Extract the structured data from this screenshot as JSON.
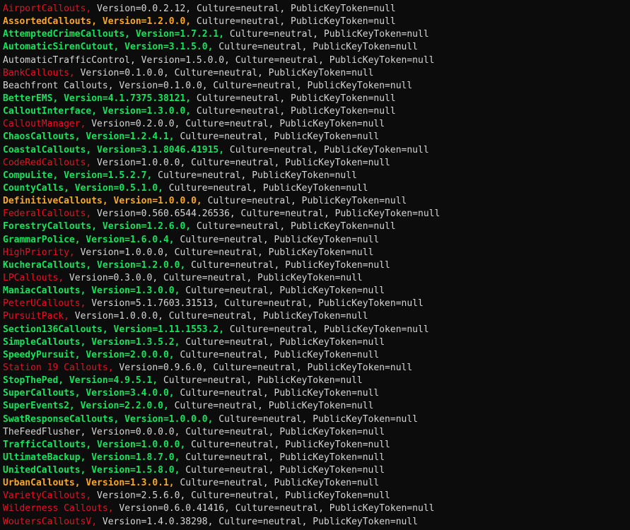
{
  "colors": {
    "background": "#0c0c0c",
    "red": "#e81123",
    "orange": "#f9a825",
    "green": "#16e35c",
    "white": "#d6d6d6",
    "partial_top_line": "#2a6fdb"
  },
  "lines": [
    {
      "name": "AirportCallouts,",
      "info": " Version=0.0.2.12, Culture=neutral, PublicKeyToken=null",
      "color": "red"
    },
    {
      "name": "AssortedCallouts, Version=1.2.0.0,",
      "info": " Culture=neutral, PublicKeyToken=null",
      "color": "orange"
    },
    {
      "name": "AttemptedCrimeCallouts, Version=1.7.2.1,",
      "info": " Culture=neutral, PublicKeyToken=null",
      "color": "green"
    },
    {
      "name": "AutomaticSirenCutout, Version=3.1.5.0,",
      "info": " Culture=neutral, PublicKeyToken=null",
      "color": "green"
    },
    {
      "name": "AutomaticTrafficControl,",
      "info": " Version=1.5.0.0, Culture=neutral, PublicKeyToken=null",
      "color": "white"
    },
    {
      "name": "BankCallouts,",
      "info": " Version=0.1.0.0, Culture=neutral, PublicKeyToken=null",
      "color": "red"
    },
    {
      "name": "Beachfront Callouts,",
      "info": " Version=0.1.0.0, Culture=neutral, PublicKeyToken=null",
      "color": "white"
    },
    {
      "name": "BetterEMS, Version=4.1.7375.38121,",
      "info": " Culture=neutral, PublicKeyToken=null",
      "color": "green"
    },
    {
      "name": "CalloutInterface, Version=1.3.0.0,",
      "info": " Culture=neutral, PublicKeyToken=null",
      "color": "green"
    },
    {
      "name": "CalloutManager,",
      "info": " Version=0.2.0.0, Culture=neutral, PublicKeyToken=null",
      "color": "red"
    },
    {
      "name": "ChaosCallouts, Version=1.2.4.1,",
      "info": " Culture=neutral, PublicKeyToken=null",
      "color": "green"
    },
    {
      "name": "CoastalCallouts, Version=3.1.8046.41915,",
      "info": " Culture=neutral, PublicKeyToken=null",
      "color": "green"
    },
    {
      "name": "CodeRedCallouts,",
      "info": " Version=1.0.0.0, Culture=neutral, PublicKeyToken=null",
      "color": "red"
    },
    {
      "name": "CompuLite, Version=1.5.2.7,",
      "info": " Culture=neutral, PublicKeyToken=null",
      "color": "green"
    },
    {
      "name": "CountyCalls, Version=0.5.1.0,",
      "info": " Culture=neutral, PublicKeyToken=null",
      "color": "green"
    },
    {
      "name": "DefinitiveCallouts, Version=1.0.0.0,",
      "info": " Culture=neutral, PublicKeyToken=null",
      "color": "orange"
    },
    {
      "name": "FederalCallouts,",
      "info": " Version=0.560.6544.26536, Culture=neutral, PublicKeyToken=null",
      "color": "red"
    },
    {
      "name": "ForestryCallouts, Version=1.2.6.0,",
      "info": " Culture=neutral, PublicKeyToken=null",
      "color": "green"
    },
    {
      "name": "GrammarPolice, Version=1.6.0.4,",
      "info": " Culture=neutral, PublicKeyToken=null",
      "color": "green"
    },
    {
      "name": "HighPriority,",
      "info": " Version=1.0.0.0, Culture=neutral, PublicKeyToken=null",
      "color": "red"
    },
    {
      "name": "KucheraCallouts, Version=1.2.0.0,",
      "info": " Culture=neutral, PublicKeyToken=null",
      "color": "green"
    },
    {
      "name": "LPCallouts,",
      "info": " Version=0.3.0.0, Culture=neutral, PublicKeyToken=null",
      "color": "red"
    },
    {
      "name": "ManiacCallouts, Version=1.3.0.0,",
      "info": " Culture=neutral, PublicKeyToken=null",
      "color": "green"
    },
    {
      "name": "PeterUCallouts,",
      "info": " Version=5.1.7603.31513, Culture=neutral, PublicKeyToken=null",
      "color": "red"
    },
    {
      "name": "PursuitPack,",
      "info": " Version=1.0.0.0, Culture=neutral, PublicKeyToken=null",
      "color": "red"
    },
    {
      "name": "Section136Callouts, Version=1.11.1553.2,",
      "info": " Culture=neutral, PublicKeyToken=null",
      "color": "green"
    },
    {
      "name": "SimpleCallouts, Version=1.3.5.2,",
      "info": " Culture=neutral, PublicKeyToken=null",
      "color": "green"
    },
    {
      "name": "SpeedyPursuit, Version=2.0.0.0,",
      "info": " Culture=neutral, PublicKeyToken=null",
      "color": "green"
    },
    {
      "name": "Station 19 Callouts,",
      "info": " Version=0.9.6.0, Culture=neutral, PublicKeyToken=null",
      "color": "red"
    },
    {
      "name": "StopThePed, Version=4.9.5.1,",
      "info": " Culture=neutral, PublicKeyToken=null",
      "color": "green"
    },
    {
      "name": "SuperCallouts, Version=3.4.0.0,",
      "info": " Culture=neutral, PublicKeyToken=null",
      "color": "green"
    },
    {
      "name": "SuperEvents2, Version=2.2.0.0,",
      "info": " Culture=neutral, PublicKeyToken=null",
      "color": "green"
    },
    {
      "name": "SwatResponseCallouts, Version=1.0.0.0,",
      "info": " Culture=neutral, PublicKeyToken=null",
      "color": "green"
    },
    {
      "name": "TheFeedFlusher,",
      "info": " Version=0.0.0.0, Culture=neutral, PublicKeyToken=null",
      "color": "white"
    },
    {
      "name": "TrafficCallouts, Version=1.0.0.0,",
      "info": " Culture=neutral, PublicKeyToken=null",
      "color": "green"
    },
    {
      "name": "UltimateBackup, Version=1.8.7.0,",
      "info": " Culture=neutral, PublicKeyToken=null",
      "color": "green"
    },
    {
      "name": "UnitedCallouts, Version=1.5.8.0,",
      "info": " Culture=neutral, PublicKeyToken=null",
      "color": "green"
    },
    {
      "name": "UrbanCallouts, Version=1.3.0.1,",
      "info": " Culture=neutral, PublicKeyToken=null",
      "color": "orange"
    },
    {
      "name": "VarietyCallouts,",
      "info": " Version=2.5.6.0, Culture=neutral, PublicKeyToken=null",
      "color": "red"
    },
    {
      "name": "Wilderness Callouts,",
      "info": " Version=0.6.0.41416, Culture=neutral, PublicKeyToken=null",
      "color": "red"
    },
    {
      "name": "WoutersCalloutsV,",
      "info": " Version=1.4.0.38298, Culture=neutral, PublicKeyToken=null",
      "color": "red"
    }
  ]
}
